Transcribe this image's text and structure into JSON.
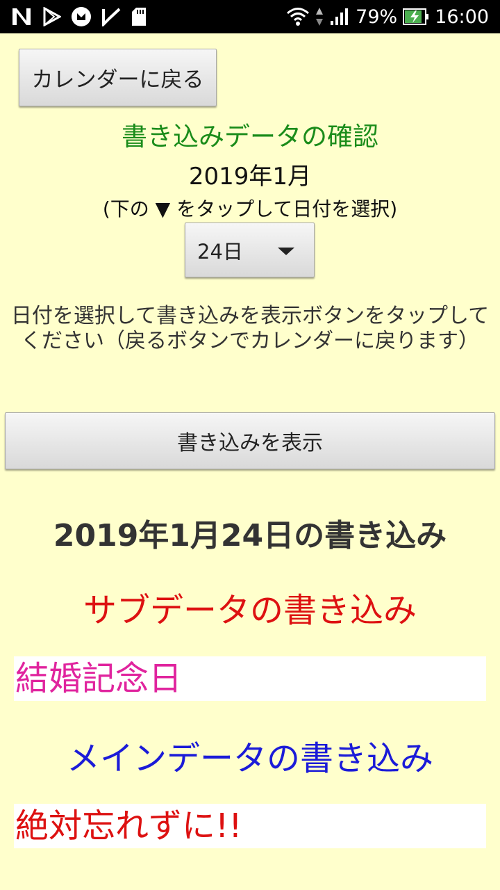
{
  "status_bar": {
    "battery": "79%",
    "time": "16:00"
  },
  "toolbar": {
    "back_label": "カレンダーに戻る"
  },
  "header": {
    "title": "書き込みデータの確認",
    "month": "2019年1月",
    "hint": "(下の ▼ をタップして日付を選択)"
  },
  "date_select": {
    "value": "24日"
  },
  "instruction": "日付を選択して書き込みを表示ボタンをタップしてください（戻るボタンでカレンダーに戻ります）",
  "show_button_label": "書き込みを表示",
  "result": {
    "heading": "2019年1月24日の書き込み",
    "sub_heading": "サブデータの書き込み",
    "sub_entry": "結婚記念日",
    "main_heading": "メインデータの書き込み",
    "main_entry": "絶対忘れずに!!"
  },
  "colors": {
    "background": "#ffffcc",
    "title": "#1a8c1a",
    "sub_heading": "#dd1111",
    "sub_entry": "#e0249e",
    "main_heading": "#1b1bd8",
    "main_entry": "#dd1111"
  },
  "icons": [
    "n-notification-icon",
    "play-store-icon",
    "app-badge-icon",
    "check-flag-icon",
    "sd-card-icon",
    "wifi-icon",
    "data-arrows-icon",
    "cell-signal-icon",
    "battery-charging-icon"
  ]
}
